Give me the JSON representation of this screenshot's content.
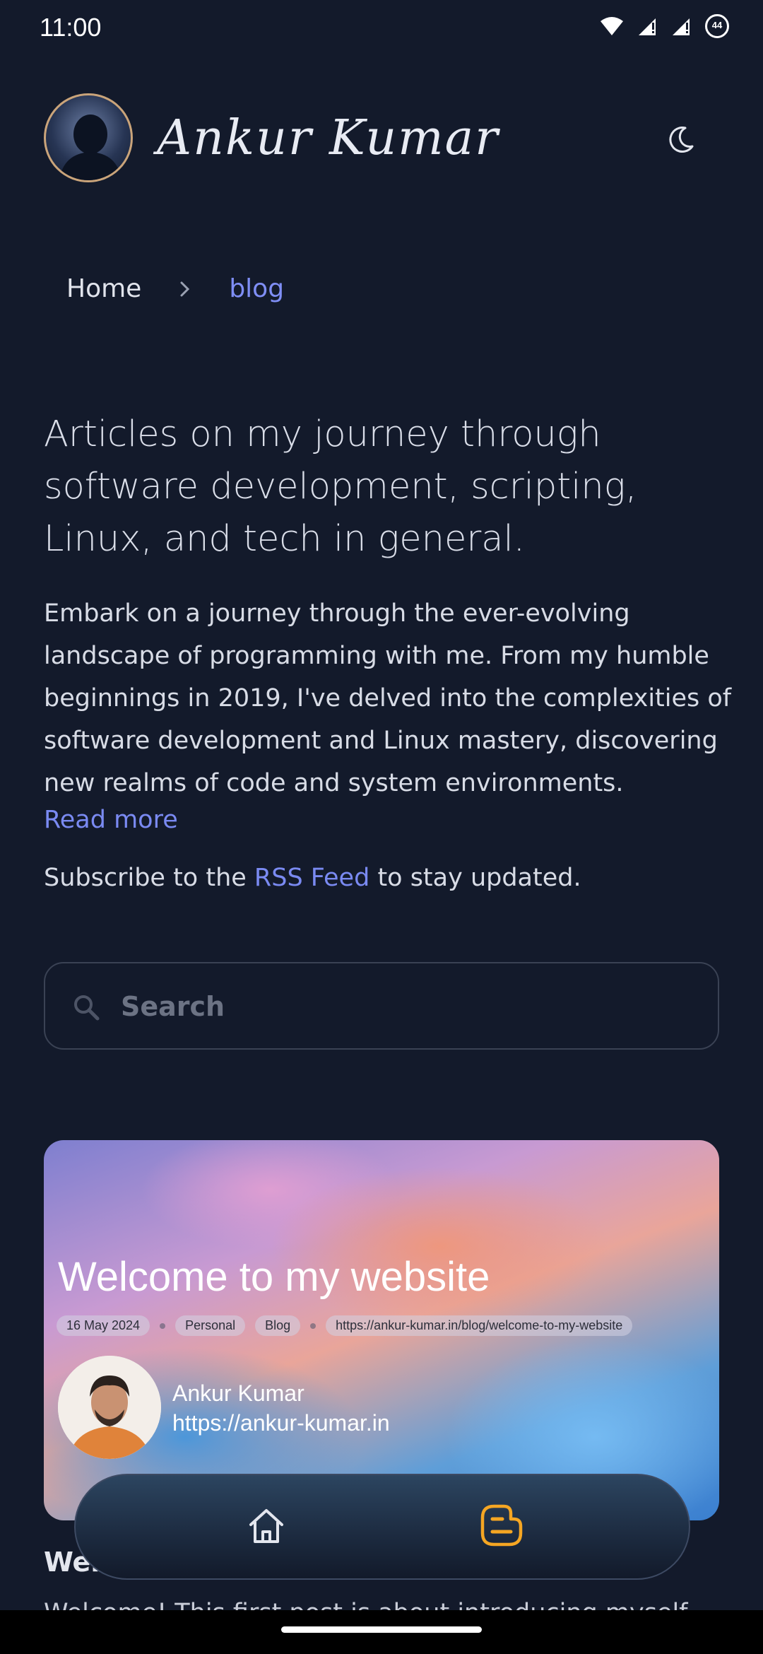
{
  "status_bar": {
    "time": "11:00",
    "battery": "44"
  },
  "header": {
    "site_title": "Ankur Kumar",
    "theme_icon": "moon-icon"
  },
  "breadcrumb": {
    "home": "Home",
    "separator_icon": "chevron-right-icon",
    "current": "blog"
  },
  "main": {
    "heading": "Articles on my journey through software development, scripting, Linux, and tech in general.",
    "intro": "Embark on a journey through the ever-evolving landscape of programming with me. From my humble beginnings in 2019, I've delved into the complexities of software development and Linux mastery, discovering new realms of code and system environments.",
    "read_more": "Read more",
    "subscribe_prefix": "Subscribe to the ",
    "subscribe_link": "RSS Feed",
    "subscribe_suffix": " to stay updated."
  },
  "search": {
    "placeholder": "Search",
    "value": ""
  },
  "post": {
    "card_title": "Welcome to my website",
    "date": "16 May 2024",
    "tags": [
      "Personal",
      "Blog"
    ],
    "url": "https://ankur-kumar.in/blog/welcome-to-my-website",
    "author": "Ankur Kumar",
    "author_url": "https://ankur-kumar.in",
    "title": "Welcome to my website",
    "excerpt": "Welcome! This first post is about introducing myself"
  },
  "bottom_nav": {
    "items": [
      {
        "icon": "home-icon"
      },
      {
        "icon": "blogger-icon",
        "active": true
      }
    ]
  },
  "colors": {
    "background": "#131a2b",
    "accent": "#7a8af2",
    "nav_active": "#f5a623"
  }
}
